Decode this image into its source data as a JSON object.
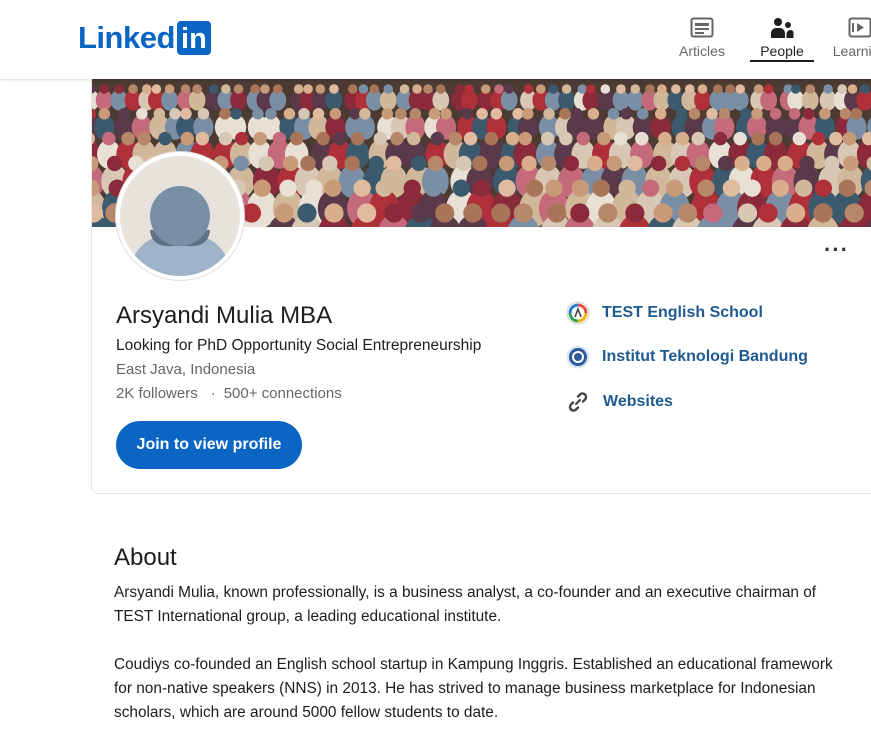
{
  "nav": {
    "logo_text": "Linked",
    "logo_box": "in",
    "items": [
      {
        "label": "Articles",
        "icon": "articles-icon"
      },
      {
        "label": "People",
        "icon": "people-icon",
        "active": true
      },
      {
        "label": "Learning",
        "icon": "learning-icon"
      }
    ]
  },
  "profile": {
    "name": "Arsyandi Mulia MBA",
    "headline": "Looking for PhD Opportunity Social Entrepreneurship",
    "location": "East Java, Indonesia",
    "followers": "2K followers",
    "separator": "·",
    "connections": "500+ connections",
    "join_button": "Join to view profile",
    "more_label": "···",
    "links": [
      {
        "label": "TEST English School",
        "icon": "company-logo-icon"
      },
      {
        "label": "Institut Teknologi Bandung",
        "icon": "school-logo-icon"
      },
      {
        "label": "Websites",
        "icon": "link-icon"
      }
    ]
  },
  "about": {
    "title": "About",
    "paragraphs": [
      "Arsyandi Mulia, known professionally, is a business analyst, a co-founder and an executive chairman of TEST International group, a leading educational institute.",
      "Coudiys co-founded an English school startup in Kampung Inggris. Established an educational framework for non-native speakers (NNS) in 2013. He has strived to manage business marketplace for Indonesian scholars, which are around 5000 fellow students to date."
    ]
  },
  "colors": {
    "brand": "#0a66c2",
    "link": "#1f5a8f",
    "text": "#1d1d1d",
    "muted": "#666666"
  }
}
